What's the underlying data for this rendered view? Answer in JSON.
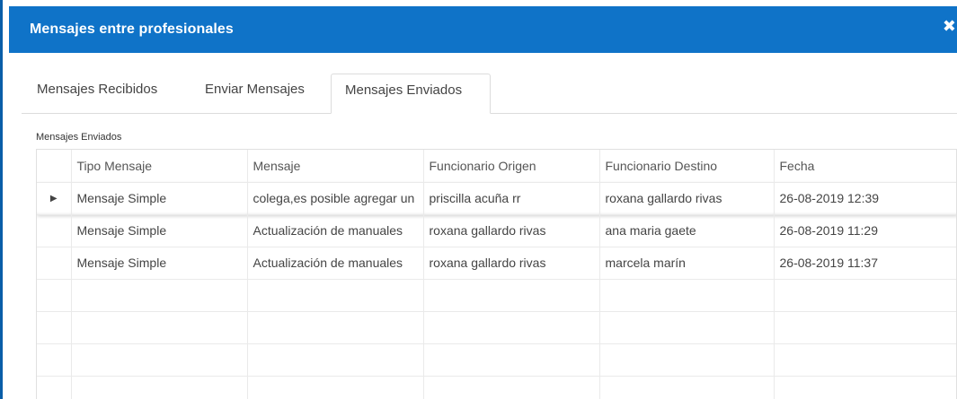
{
  "window": {
    "title": "Mensajes entre profesionales",
    "close_glyph": "✕",
    "close_icon": "close-icon"
  },
  "tabs": [
    {
      "label": "Mensajes Recibidos",
      "active": false
    },
    {
      "label": "Enviar Mensajes",
      "active": false
    },
    {
      "label": "Mensajes Enviados",
      "active": true
    }
  ],
  "section_label": "Mensajes Enviados",
  "table": {
    "columns": [
      "Tipo Mensaje",
      "Mensaje",
      "Funcionario Origen",
      "Funcionario Destino",
      "Fecha"
    ],
    "selected_indicator": "▶",
    "rows": [
      [
        "Mensaje Simple",
        "colega,es posible agregar un",
        "priscilla acuña rr",
        "roxana gallardo rivas",
        "26-08-2019 12:39"
      ],
      [
        "Mensaje Simple",
        "Actualización de manuales",
        "roxana gallardo rivas",
        "ana maria gaete",
        "26-08-2019 11:29"
      ],
      [
        "Mensaje Simple",
        "Actualización de manuales",
        "roxana gallardo rivas",
        "marcela marín",
        "26-08-2019 11:37"
      ]
    ]
  },
  "colors": {
    "titlebar": "#0f73c8",
    "frame_border": "#0a5ea8"
  }
}
